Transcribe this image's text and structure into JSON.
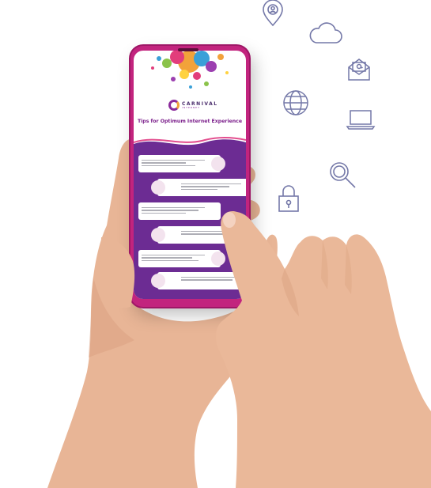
{
  "phone_screen": {
    "brand_name": "CARNIVAL",
    "brand_tagline": "INTERNET",
    "title": "Tips for Optimum Internet Experience"
  },
  "colors": {
    "accent_magenta": "#c2247e",
    "accent_purple": "#6c2c93",
    "icon_stroke": "#7478a8",
    "skin": "#e8b596"
  },
  "floating_icons": [
    "location-user-icon",
    "cloud-icon",
    "email-icon",
    "globe-icon",
    "laptop-icon",
    "search-icon",
    "lock-icon"
  ]
}
